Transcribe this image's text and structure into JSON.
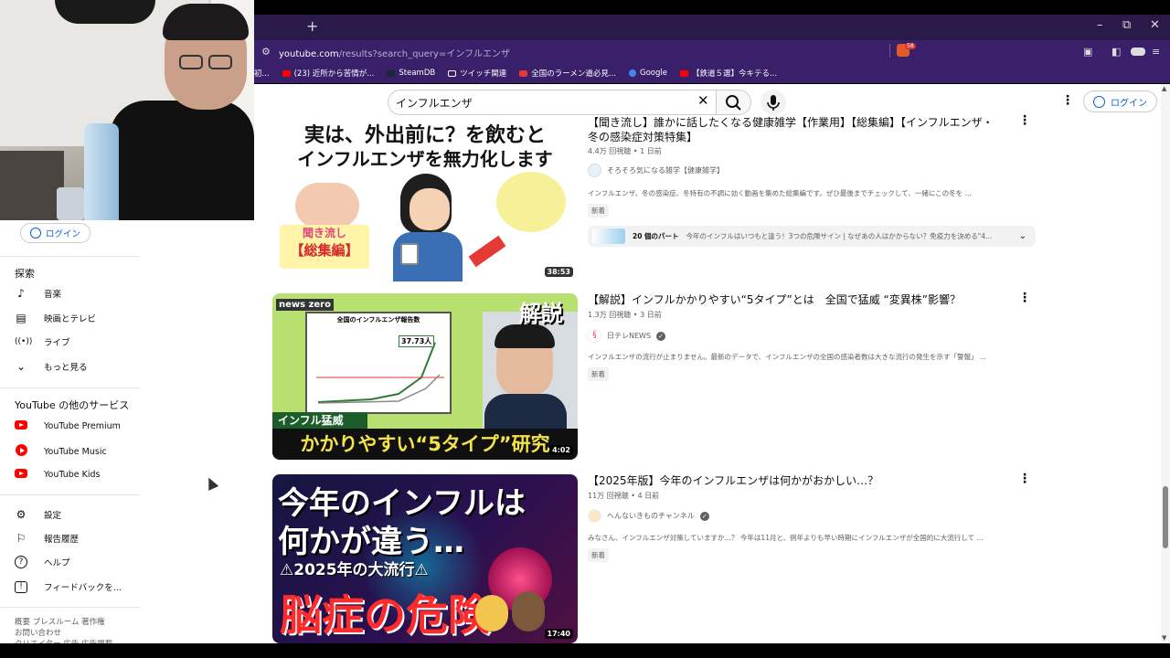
{
  "browser": {
    "new_tab": "+",
    "url_host": "youtube.com",
    "url_path": "/results?search_query=インフルエンザ",
    "ext_badge": "58",
    "window_controls": {
      "minimize": "–",
      "restore": "⧉",
      "close": "✕"
    },
    "bookmarks": [
      {
        "label": "初...",
        "color": "#888888"
      },
      {
        "label": "(23) 近所から苦情が...",
        "color": "#ff0000"
      },
      {
        "label": "SteamDB",
        "color": "#1b2838"
      },
      {
        "label": "ツイッチ関連",
        "color": "#ffffff"
      },
      {
        "label": "全国のラーメン道必見...",
        "color": "#e53935"
      },
      {
        "label": "Google",
        "color": "#4285f4"
      },
      {
        "label": "【鉄道５選】今キテる...",
        "color": "#ff0000"
      }
    ]
  },
  "header": {
    "search_value": "インフルエンザ",
    "login_label": "ログイン"
  },
  "sidebar": {
    "login_label": "ログイン",
    "explore_title": "探索",
    "explore_items": [
      {
        "label": "音楽",
        "icon": "music-note-icon"
      },
      {
        "label": "映画とテレビ",
        "icon": "film-icon"
      },
      {
        "label": "ライブ",
        "icon": "live-icon"
      },
      {
        "label": "もっと見る",
        "icon": "chevron-down-icon"
      }
    ],
    "services_title": "YouTube の他のサービス",
    "services": [
      {
        "label": "YouTube Premium"
      },
      {
        "label": "YouTube Music"
      },
      {
        "label": "YouTube Kids"
      }
    ],
    "settings_items": [
      {
        "label": "設定",
        "icon": "gear-icon"
      },
      {
        "label": "報告履歴",
        "icon": "flag-icon"
      },
      {
        "label": "ヘルプ",
        "icon": "help-icon"
      },
      {
        "label": "フィードバックを...",
        "icon": "feedback-icon"
      }
    ],
    "footer_line1": "概要  プレスルーム  著作権",
    "footer_line2": "お問い合わせ",
    "footer_line3": "クリエイター  広告  広告掲載"
  },
  "results": [
    {
      "title": "【聞き流し】誰かに話したくなる健康雑学【作業用】【総集編】【インフルエンザ・冬の感染症対策特集】",
      "meta": "4.4万 回視聴 • 1 日前",
      "channel": "そろそろ気になる雑学【健康雑学】",
      "verified": false,
      "desc": "インフルエンザ、冬の感染症、冬特有の不調に効く動画を集めた総集編です。ぜひ最後までチェックして、一緒にこの冬を ...",
      "badge": "新着",
      "duration": "38:53",
      "thumb_line1": "実は、外出前に？を飲むと",
      "thumb_line2": "インフルエンザを無力化します",
      "thumb_tag1": "聞き流し",
      "thumb_tag2": "【総集編】",
      "parts_count": "20 個のパート",
      "parts_text": "今年のインフルはいつもと違う！3つの危険サイン | なぜあの人はかからない？免疫力を決める\"4..."
    },
    {
      "title": "【解説】インフルかかりやすい“5タイプ”とは　全国で猛威 “変異株”影響？",
      "meta": "1.3万 回視聴 • 3 日前",
      "channel": "日テレNEWS",
      "verified": true,
      "desc": "インフルエンザの流行が止まりません。最新のデータで、インフルエンザの全国の感染者数は大きな流行の発生を示す「警報」 ...",
      "badge": "新着",
      "duration": "4:02",
      "thumb_logo": "news zero",
      "thumb_kaisetsu": "解説",
      "thumb_chart_title": "全国のインフルエンザ報告数",
      "thumb_chart_value": "37.73人",
      "thumb_banner": "インフル猛威",
      "thumb_caption": "かかりやすい“5タイプ”研究"
    },
    {
      "title": "【2025年版】今年のインフルエンザは何かがおかしい…？",
      "meta": "11万 回視聴 • 4 日前",
      "channel": "へんないきものチャンネル",
      "verified": true,
      "desc": "みなさん、インフルエンザ対策していますか…？ 今年は11月と、例年よりも早い時期にインフルエンザが全国的に大流行して ...",
      "badge": "新着",
      "duration": "17:40",
      "thumb_line1": "今年のインフルは",
      "thumb_line2": "何かが違う…",
      "thumb_line3": "⚠2025年の大流行⚠",
      "thumb_line4": "脳症の危険"
    }
  ]
}
